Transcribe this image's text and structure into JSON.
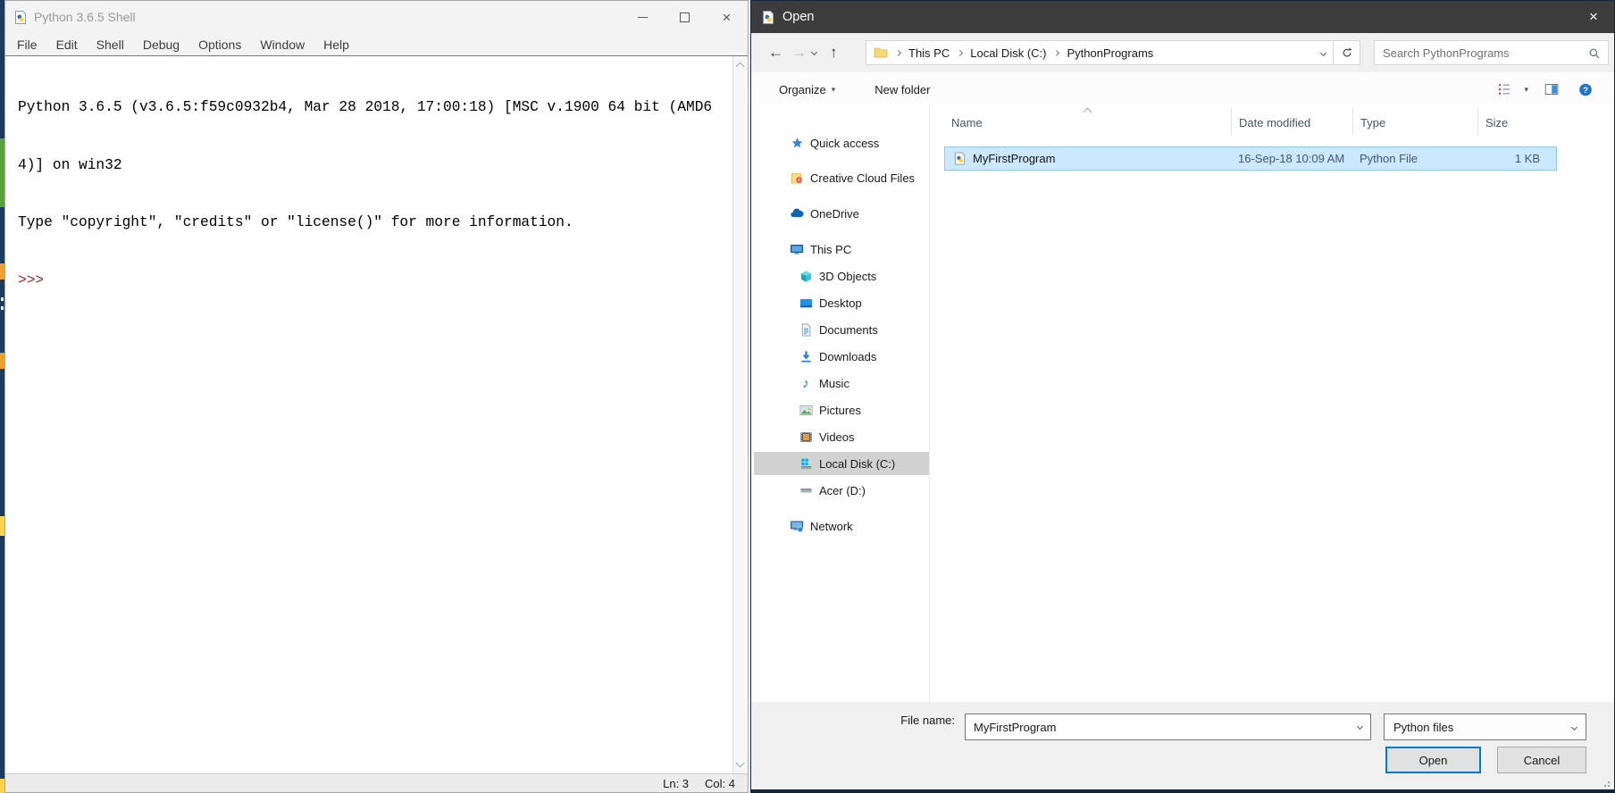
{
  "idle_window": {
    "title": "Python 3.6.5 Shell",
    "menu_items": [
      "File",
      "Edit",
      "Shell",
      "Debug",
      "Options",
      "Window",
      "Help"
    ],
    "shell_lines": [
      "Python 3.6.5 (v3.6.5:f59c0932b4, Mar 28 2018, 17:00:18) [MSC v.1900 64 bit (AMD6",
      "4)] on win32",
      "Type \"copyright\", \"credits\" or \"license()\" for more information."
    ],
    "prompt": ">>>",
    "status_ln": "Ln: 3",
    "status_col": "Col: 4"
  },
  "open_dialog": {
    "title": "Open",
    "nav": {
      "breadcrumb": [
        "This PC",
        "Local Disk (C:)",
        "PythonPrograms"
      ],
      "search_placeholder": "Search PythonPrograms"
    },
    "toolbar": {
      "organize": "Organize",
      "new_folder": "New folder"
    },
    "sidebar": [
      {
        "label": "Quick access"
      },
      {
        "label": "Creative Cloud Files"
      },
      {
        "label": "OneDrive"
      },
      {
        "label": "This PC"
      },
      {
        "label": "3D Objects"
      },
      {
        "label": "Desktop"
      },
      {
        "label": "Documents"
      },
      {
        "label": "Downloads"
      },
      {
        "label": "Music"
      },
      {
        "label": "Pictures"
      },
      {
        "label": "Videos"
      },
      {
        "label": "Local Disk (C:)"
      },
      {
        "label": "Acer (D:)"
      },
      {
        "label": "Network"
      }
    ],
    "list": {
      "columns": [
        "Name",
        "Date modified",
        "Type",
        "Size"
      ],
      "rows": [
        {
          "name": "MyFirstProgram",
          "date_modified": "16-Sep-18 10:09 AM",
          "type": "Python File",
          "size": "1 KB"
        }
      ]
    },
    "footer": {
      "file_name_label": "File name:",
      "file_name_value": "MyFirstProgram",
      "file_type_value": "Python files",
      "open_label": "Open",
      "cancel_label": "Cancel"
    }
  },
  "icons": {
    "close": "×",
    "back": "←",
    "forward": "→",
    "up": "↑",
    "music": "♪",
    "caret": "▾",
    "help": "?"
  },
  "colors": {
    "accent_blue": "#0078d7",
    "selection_blue": "#cce8ff",
    "dialog_titlebar": "#3c3c3c",
    "prompt_red": "#b22222",
    "sidebar_selected": "#d2d2d2",
    "strip_green": "#5aa13c",
    "strip_orange": "#f0a030",
    "strip_yellow": "#ffd34d"
  }
}
